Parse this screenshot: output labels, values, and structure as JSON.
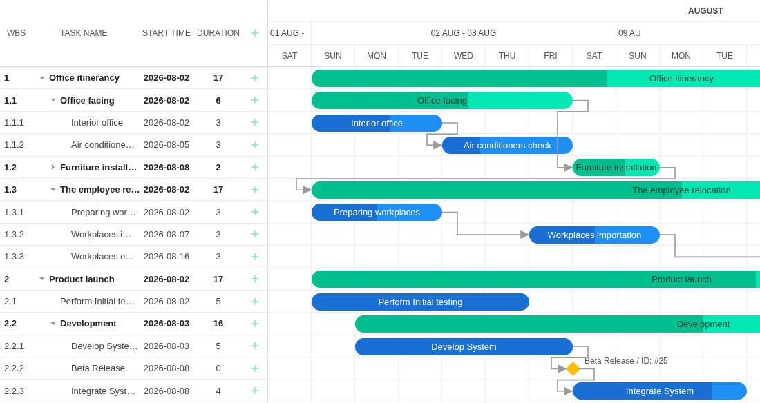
{
  "grid": {
    "columns": [
      "WBS",
      "TASK NAME",
      "START TIME",
      "DURATION"
    ]
  },
  "timeline": {
    "month": "AUGUST",
    "weeks": [
      "01 AUG -",
      "02 AUG - 08 AUG",
      "09 AU"
    ],
    "days": [
      "SAT",
      "SUN",
      "MON",
      "TUE",
      "WED",
      "THU",
      "FRI",
      "SAT",
      "SUN",
      "MON",
      "TUE"
    ]
  },
  "tasks": [
    {
      "wbs": "1",
      "name": "Office itinerancy",
      "start": "2026-08-02",
      "duration": "17",
      "kind": "project",
      "expanded": true,
      "level": 0.4,
      "bar_label": "Office itinerancy",
      "children": [
        {
          "wbs": "1.1",
          "name": "Office facing",
          "start": "2026-08-02",
          "duration": "6",
          "kind": "project",
          "expanded": true,
          "level": 0.6,
          "bar_label": "Office facing",
          "children": [
            {
              "wbs": "1.1.1",
              "name": "Interior office",
              "start": "2026-08-02",
              "duration": "3",
              "kind": "task",
              "level": 0.6,
              "bar_label": "Interior office"
            },
            {
              "wbs": "1.1.2",
              "name": "Air conditione…",
              "start": "2026-08-05",
              "duration": "3",
              "kind": "task",
              "level": 0.29,
              "bar_label": "Air conditioners check"
            }
          ]
        },
        {
          "wbs": "1.2",
          "name": "Furniture install…",
          "start": "2026-08-08",
          "duration": "2",
          "kind": "project",
          "expanded": false,
          "level": 0.6,
          "bar_label": "Furniture installation"
        },
        {
          "wbs": "1.3",
          "name": "The employee re…",
          "start": "2026-08-02",
          "duration": "17",
          "kind": "project",
          "expanded": true,
          "level": 0.5,
          "bar_label": "The employee relocation",
          "children": [
            {
              "wbs": "1.3.1",
              "name": "Preparing wor…",
              "start": "2026-08-02",
              "duration": "3",
              "kind": "task",
              "level": 0.5,
              "bar_label": "Preparing workplaces"
            },
            {
              "wbs": "1.3.2",
              "name": "Workplaces i…",
              "start": "2026-08-07",
              "duration": "3",
              "kind": "task",
              "level": 0.5,
              "bar_label": "Workplaces importation"
            },
            {
              "wbs": "1.3.3",
              "name": "Workplaces e…",
              "start": "2026-08-16",
              "duration": "3",
              "kind": "task"
            }
          ]
        }
      ]
    },
    {
      "wbs": "2",
      "name": "Product launch",
      "start": "2026-08-02",
      "duration": "17",
      "kind": "project",
      "expanded": true,
      "level": 0.6,
      "bar_label": "Product launch",
      "children": [
        {
          "wbs": "2.1",
          "name": "Perform Initial te…",
          "start": "2026-08-02",
          "duration": "5",
          "kind": "task",
          "level": 1,
          "bar_label": "Perform Initial testing"
        },
        {
          "wbs": "2.2",
          "name": "Development",
          "start": "2026-08-03",
          "duration": "16",
          "kind": "project",
          "expanded": true,
          "level": 0.5,
          "bar_label": "Development",
          "children": [
            {
              "wbs": "2.2.1",
              "name": "Develop Syste…",
              "start": "2026-08-03",
              "duration": "5",
              "kind": "task",
              "level": 1,
              "bar_label": "Develop System"
            },
            {
              "wbs": "2.2.2",
              "name": "Beta Release",
              "start": "2026-08-08",
              "duration": "0",
              "kind": "milestone",
              "bar_label": "Beta Release / ID: #25"
            },
            {
              "wbs": "2.2.3",
              "name": "Integrate Syst…",
              "start": "2026-08-08",
              "duration": "4",
              "kind": "task",
              "level": 0.8,
              "bar_label": "Integrate System"
            }
          ]
        }
      ]
    }
  ],
  "chart": {
    "kind": "gantt"
  }
}
